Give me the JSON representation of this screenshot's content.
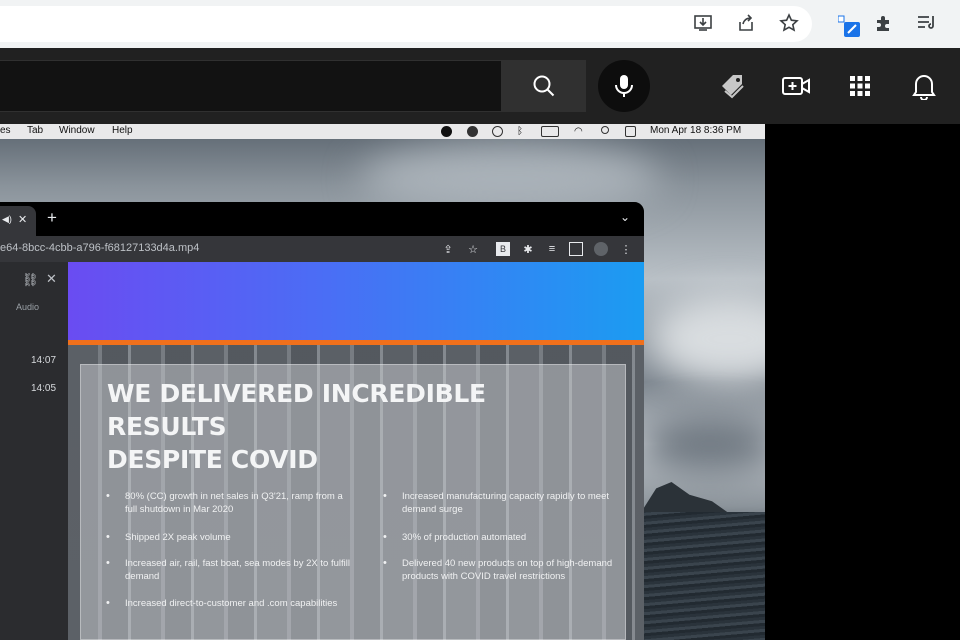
{
  "mac_menubar": {
    "items": [
      "es",
      "Tab",
      "Window",
      "Help"
    ],
    "clock": "Mon Apr 18  8:36 PM"
  },
  "inner_browser": {
    "url": "e64-8bcc-4cbb-a796-f68127133d4a.mp4",
    "new_tab": "+",
    "tab_close": "✕"
  },
  "side_panel": {
    "audio_label": "Audio",
    "times": [
      "14:07",
      "14:05"
    ]
  },
  "slide": {
    "title_line1": "WE DELIVERED INCREDIBLE RESULTS",
    "title_line2": "DESPITE COVID",
    "left_bullets": [
      "80% (CC) growth in net sales in Q3'21, ramp from a full shutdown in Mar 2020",
      "Shipped 2X peak volume",
      "Increased air, rail, fast boat, sea modes by 2X to fulfill demand",
      "Increased direct-to-customer and .com capabilities"
    ],
    "right_bullets": [
      "Increased manufacturing capacity rapidly to meet demand surge",
      "30% of production automated",
      "Delivered 40 new products on top of high-demand products with COVID travel restrictions"
    ]
  },
  "colors": {
    "yt_header": "#212121",
    "banner_start": "#6a4cf2",
    "banner_end": "#1b9cf2",
    "accent_orange": "#f0701c"
  }
}
